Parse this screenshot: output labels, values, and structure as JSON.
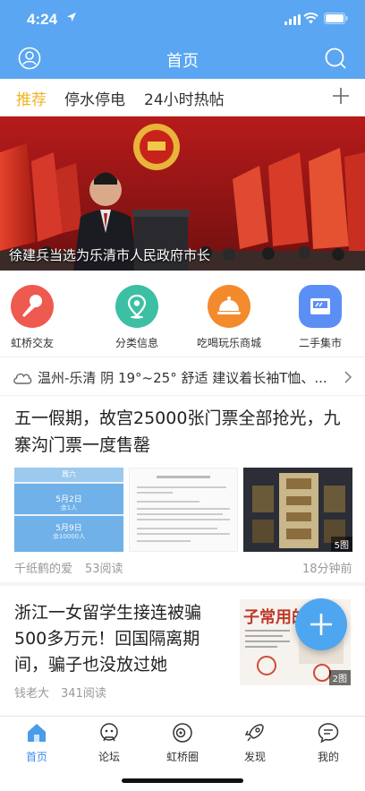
{
  "status_bar": {
    "time": "4:24"
  },
  "header": {
    "title": "首页"
  },
  "tabs": [
    {
      "label": "推荐",
      "active": true
    },
    {
      "label": "停水停电",
      "active": false
    },
    {
      "label": "24小时热帖",
      "active": false
    }
  ],
  "banner": {
    "caption": "徐建兵当选为乐清市人民政府市长"
  },
  "quick_links": [
    {
      "label": "虹桥交友",
      "color": "#ee5a4f",
      "icon": "microphone-icon"
    },
    {
      "label": "分类信息",
      "color": "#3cbfa3",
      "icon": "location-pin-icon"
    },
    {
      "label": "吃喝玩乐商城",
      "color": "#f38a2c",
      "icon": "cloche-icon"
    },
    {
      "label": "二手集市",
      "color": "#5b8ff5",
      "icon": "shop-icon"
    }
  ],
  "weather": {
    "text": "温州-乐清 阴 19°~25° 舒适 建议着长袖T恤、..."
  },
  "articles": [
    {
      "title": "五一假期，故宫25000张门票全部抢光，九寨沟门票一度售罄",
      "author": "千纸鹤的爱",
      "reads": "53阅读",
      "time": "18分钟前",
      "thumb1": {
        "header": "周六",
        "rows": [
          "5月2日",
          "余1人",
          "5月9日",
          "余10000人"
        ]
      },
      "image_count": "5图"
    },
    {
      "title": "浙江一女留学生接连被骗500多万元！回国隔离期间，骗子也没放过她",
      "author": "钱老大",
      "reads": "341阅读",
      "image_text": "子常用的",
      "image_count": "2图"
    }
  ],
  "bottom_nav": [
    {
      "label": "首页",
      "active": true,
      "icon": "home-icon"
    },
    {
      "label": "论坛",
      "active": false,
      "icon": "forum-icon"
    },
    {
      "label": "虹桥圈",
      "active": false,
      "icon": "circle-icon"
    },
    {
      "label": "发现",
      "active": false,
      "icon": "rocket-icon"
    },
    {
      "label": "我的",
      "active": false,
      "icon": "message-icon"
    }
  ],
  "colors": {
    "primary": "#5aa6f2",
    "tab_active": "#f0b323",
    "nav_active": "#3a8ee6"
  }
}
